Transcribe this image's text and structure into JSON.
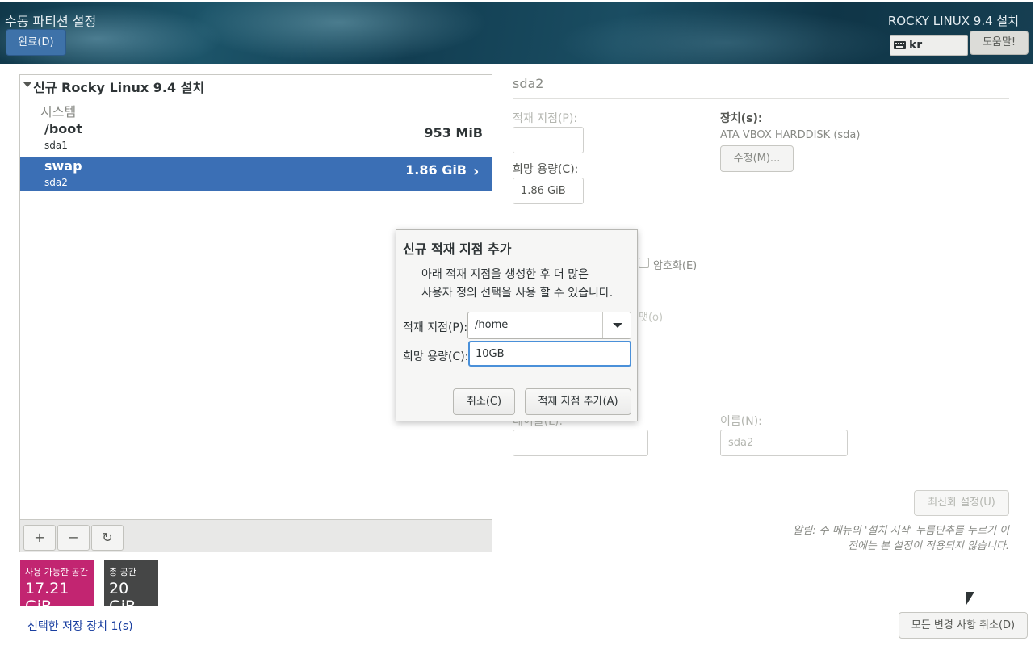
{
  "header": {
    "title": "수동 파티션 설정",
    "done_button": "완료(D)",
    "product": "ROCKY LINUX 9.4 설치",
    "keyboard_layout": "kr",
    "help_button": "도움말!"
  },
  "left_panel": {
    "install_title": "신규 Rocky Linux 9.4 설치",
    "system_label": "시스템",
    "partitions": [
      {
        "mount": "/boot",
        "device": "sda1",
        "size": "953 MiB"
      },
      {
        "mount": "swap",
        "device": "sda2",
        "size": "1.86 GiB"
      }
    ],
    "toolbar": {
      "add": "+",
      "remove": "−",
      "refresh": "↻"
    }
  },
  "space": {
    "available_label": "사용 가능한 공간",
    "available_value": "17.21 GiB",
    "total_label": "총 공간",
    "total_value": "20 GiB"
  },
  "storage_link": "선택한 저장 장치 1(s)",
  "right_panel": {
    "partition_name": "sda2",
    "mount_point_label": "적재 지점(P):",
    "mount_point_value": "",
    "desired_capacity_label": "희망 용량(C):",
    "desired_capacity_value": "1.86 GiB",
    "devices_label": "장치(s):",
    "device_value": "ATA VBOX HARDDISK (sda)",
    "modify_button": "수정(M)...",
    "encrypt_label": "암호화(E)",
    "format_label_partial": "맷(o)",
    "label_field_partial": "레이블(L):",
    "name_label": "이름(N):",
    "name_value": "sda2",
    "reset_settings_button": "최신화 설정(U)",
    "notice_line1": "알림: 주 메뉴의 '설치 시작' 누름단추를 누르기 이",
    "notice_line2": "전에는 본 설정이 적용되지 않습니다.",
    "reset_all_button": "모든 변경 사항 취소(D)"
  },
  "dialog": {
    "title": "신규 적재 지점 추가",
    "description_line1": "아래 적재 지점을 생성한 후 더 많은",
    "description_line2": "사용자 정의 선택을 사용 할 수 있습니다.",
    "mount_point_label": "적재 지점(P):",
    "mount_point_value": "/home",
    "capacity_label": "희망 용량(C):",
    "capacity_value": "10GB",
    "cancel_button": "취소(C)",
    "add_button": "적재 지점 추가(A)"
  },
  "colors": {
    "selected_row": "#3b6fb5",
    "available_space": "#c22571",
    "total_space": "#454646",
    "done_button": "#3e72a9",
    "focus_ring": "#4a90d9"
  }
}
